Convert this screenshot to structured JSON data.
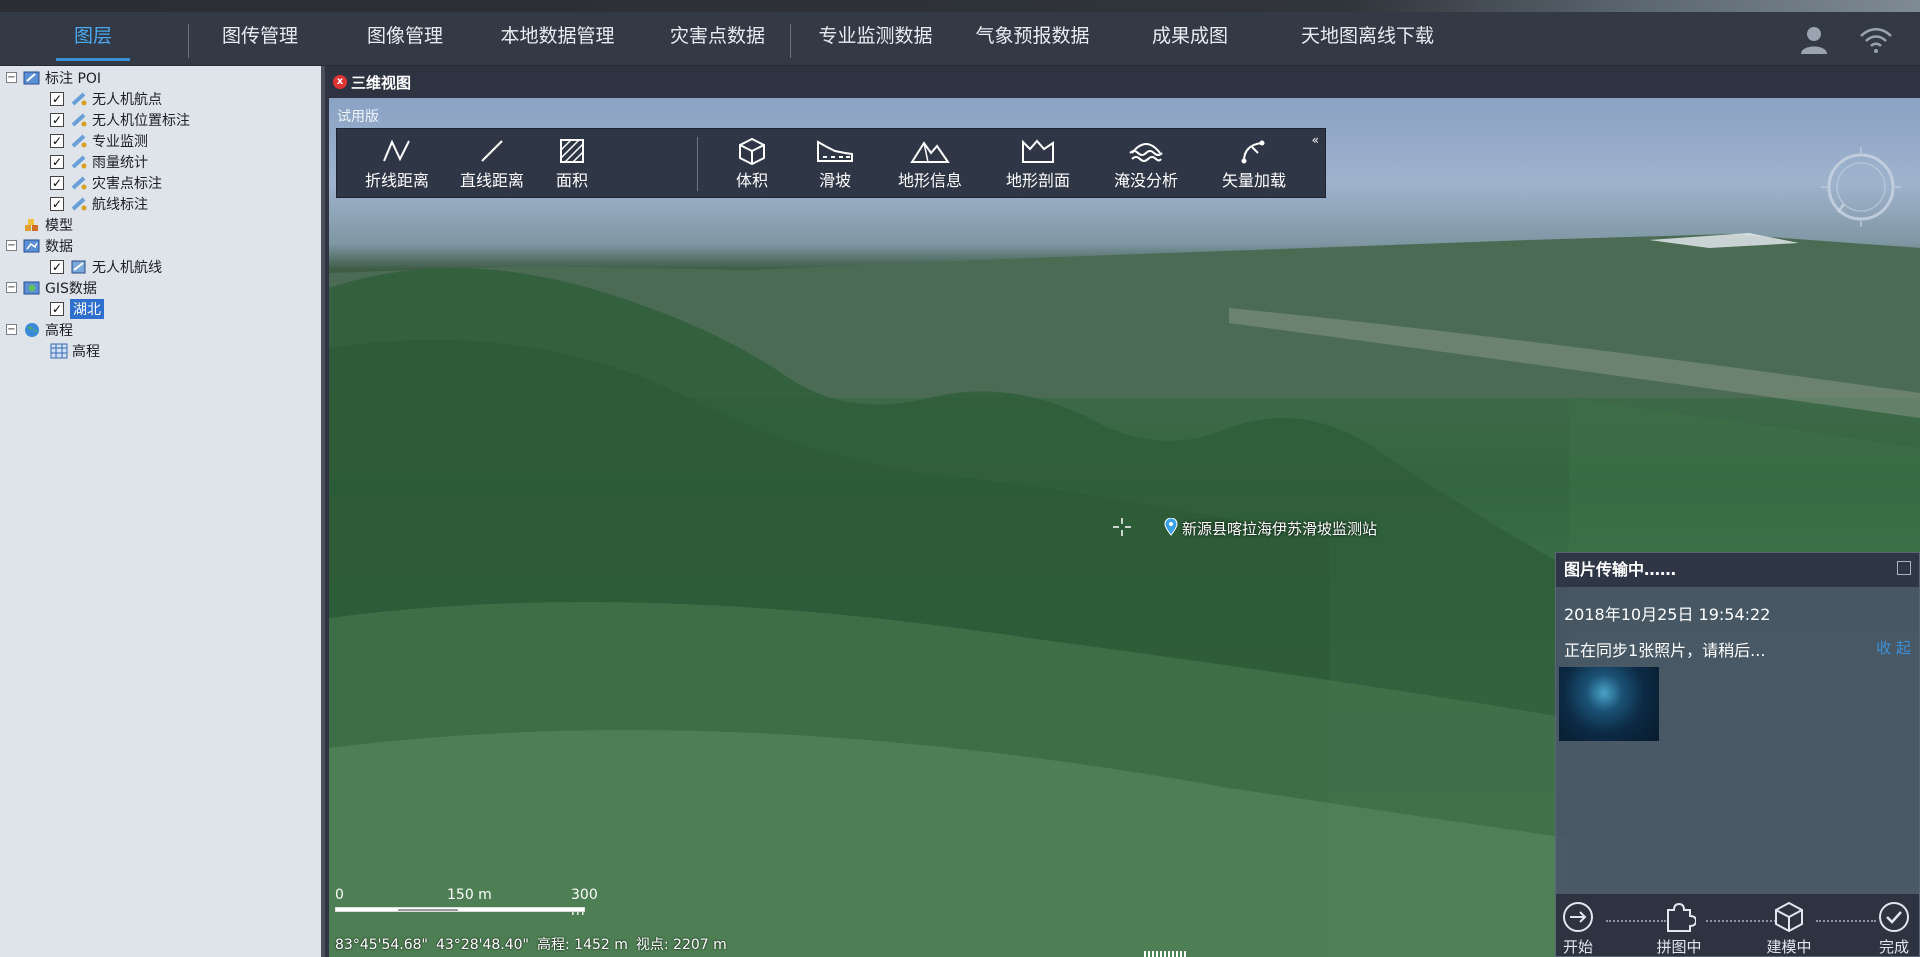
{
  "nav": {
    "items": [
      {
        "label": "图层",
        "active": true
      },
      {
        "label": "图传管理"
      },
      {
        "label": "图像管理"
      },
      {
        "label": "本地数据管理"
      },
      {
        "label": "灾害点数据"
      },
      {
        "label": "专业监测数据"
      },
      {
        "label": "气象预报数据"
      },
      {
        "label": "成果成图"
      },
      {
        "label": "天地图离线下载"
      }
    ],
    "right_icons": [
      "user-icon",
      "wifi-icon"
    ],
    "accent_color": "#3b8fd8"
  },
  "tree": {
    "nodes": [
      {
        "label": "标注 POI",
        "level": 0,
        "expanded": true,
        "icon": "annotation-folder-icon"
      },
      {
        "label": "无人机航点",
        "level": 1,
        "checked": true,
        "icon": "poi-layer-icon"
      },
      {
        "label": "无人机位置标注",
        "level": 1,
        "checked": true,
        "icon": "poi-layer-icon"
      },
      {
        "label": "专业监测",
        "level": 1,
        "checked": true,
        "icon": "poi-layer-icon"
      },
      {
        "label": "雨量统计",
        "level": 1,
        "checked": true,
        "icon": "poi-layer-icon"
      },
      {
        "label": "灾害点标注",
        "level": 1,
        "checked": true,
        "icon": "poi-layer-icon"
      },
      {
        "label": "航线标注",
        "level": 1,
        "checked": true,
        "icon": "poi-layer-icon"
      },
      {
        "label": "模型",
        "level": 0,
        "icon": "model-icon"
      },
      {
        "label": "数据",
        "level": 0,
        "expanded": true,
        "icon": "data-folder-icon"
      },
      {
        "label": "无人机航线",
        "level": 1,
        "checked": true,
        "icon": "poi-layer-icon"
      },
      {
        "label": "GIS数据",
        "level": 0,
        "expanded": true,
        "icon": "gis-folder-icon"
      },
      {
        "label": "湖北",
        "level": 1,
        "checked": true,
        "selected": true
      },
      {
        "label": "高程",
        "level": 0,
        "expanded": true,
        "icon": "globe-icon"
      },
      {
        "label": "高程",
        "level": 1,
        "icon": "grid-icon"
      }
    ]
  },
  "view": {
    "title": "三维视图",
    "trial_label": "试用版"
  },
  "toolbar": {
    "tools": [
      {
        "label": "折线距离",
        "icon": "polyline-icon"
      },
      {
        "label": "直线距离",
        "icon": "line-icon"
      },
      {
        "label": "面积",
        "icon": "area-icon"
      },
      {
        "label": "体积",
        "icon": "cube-icon"
      },
      {
        "label": "滑坡",
        "icon": "landslide-icon"
      },
      {
        "label": "地形信息",
        "icon": "mountain-icon"
      },
      {
        "label": "地形剖面",
        "icon": "profile-icon"
      },
      {
        "label": "淹没分析",
        "icon": "flood-icon"
      },
      {
        "label": "矢量加载",
        "icon": "vector-icon"
      }
    ]
  },
  "map": {
    "poi_label": "新源县喀拉海伊苏滑坡监测站",
    "scale": {
      "labels": [
        "0",
        "150 m",
        "300 m"
      ]
    },
    "coords": {
      "lon": "83°45'54.68\"",
      "lat": "43°28'48.40\"",
      "elevation": "高程: 1452 m",
      "viewpoint": "视点: 2207 m"
    }
  },
  "transfer_panel": {
    "title": "图片传输中……",
    "datetime": "2018年10月25日 19:54:22",
    "status": "正在同步1张照片，请稍后...",
    "collapse_label": "收 起",
    "steps": [
      {
        "label": "开始",
        "icon": "start-icon"
      },
      {
        "label": "拼图中",
        "icon": "puzzle-icon"
      },
      {
        "label": "建模中",
        "icon": "cube-icon"
      },
      {
        "label": "完成",
        "icon": "check-circle-icon"
      }
    ]
  }
}
